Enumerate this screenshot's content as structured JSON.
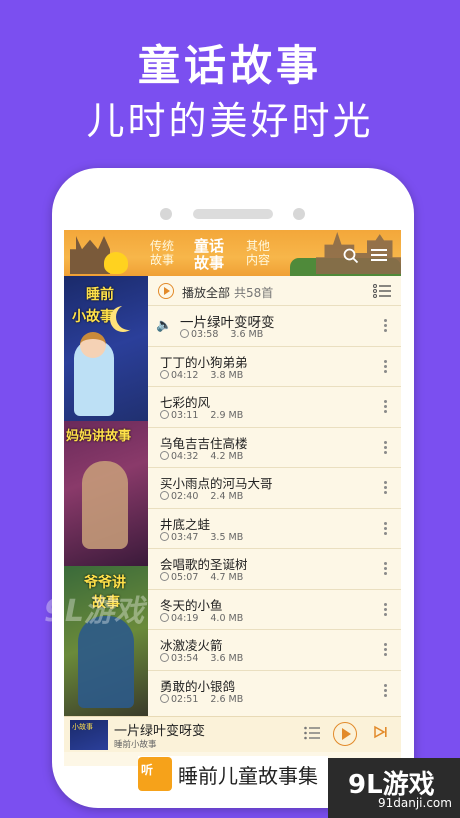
{
  "promo": {
    "title": "童话故事",
    "subtitle": "儿时的美好时光"
  },
  "tabs": [
    {
      "line1": "传统",
      "line2": "故事"
    },
    {
      "line1": "童话",
      "line2": "故事"
    },
    {
      "line1": "其他",
      "line2": "内容"
    }
  ],
  "covers": [
    {
      "title_top": "睡前",
      "title_bottom": "小故事"
    },
    {
      "title_top": "妈妈讲故事"
    },
    {
      "title_top": "爷爷讲",
      "title_bottom": "故事"
    }
  ],
  "play_all": {
    "label": "播放全部",
    "count": "共58首"
  },
  "tracks": [
    {
      "title": "一片绿叶变呀变",
      "duration": "03:58",
      "size": "3.6 MB"
    },
    {
      "title": "丁丁的小狗弟弟",
      "duration": "04:12",
      "size": "3.8 MB"
    },
    {
      "title": "七彩的风",
      "duration": "03:11",
      "size": "2.9 MB"
    },
    {
      "title": "乌龟吉吉住高楼",
      "duration": "04:32",
      "size": "4.2 MB"
    },
    {
      "title": "买小雨点的河马大哥",
      "duration": "02:40",
      "size": "2.4 MB"
    },
    {
      "title": "井底之蛙",
      "duration": "03:47",
      "size": "3.5 MB"
    },
    {
      "title": "会唱歌的圣诞树",
      "duration": "05:07",
      "size": "4.7 MB"
    },
    {
      "title": "冬天的小鱼",
      "duration": "04:19",
      "size": "4.0 MB"
    },
    {
      "title": "冰激凌火箭",
      "duration": "03:54",
      "size": "3.6 MB"
    },
    {
      "title": "勇敢的小银鸽",
      "duration": "02:51",
      "size": "2.6 MB"
    }
  ],
  "player": {
    "cover_label": "小故事",
    "title": "一片绿叶变呀变",
    "subtitle": "睡前小故事"
  },
  "banner": {
    "logo_text": "听",
    "text": "睡前儿童故事集"
  },
  "watermark": {
    "logo": "9L游戏",
    "url": "91danji.com",
    "faint": "9L游戏"
  }
}
